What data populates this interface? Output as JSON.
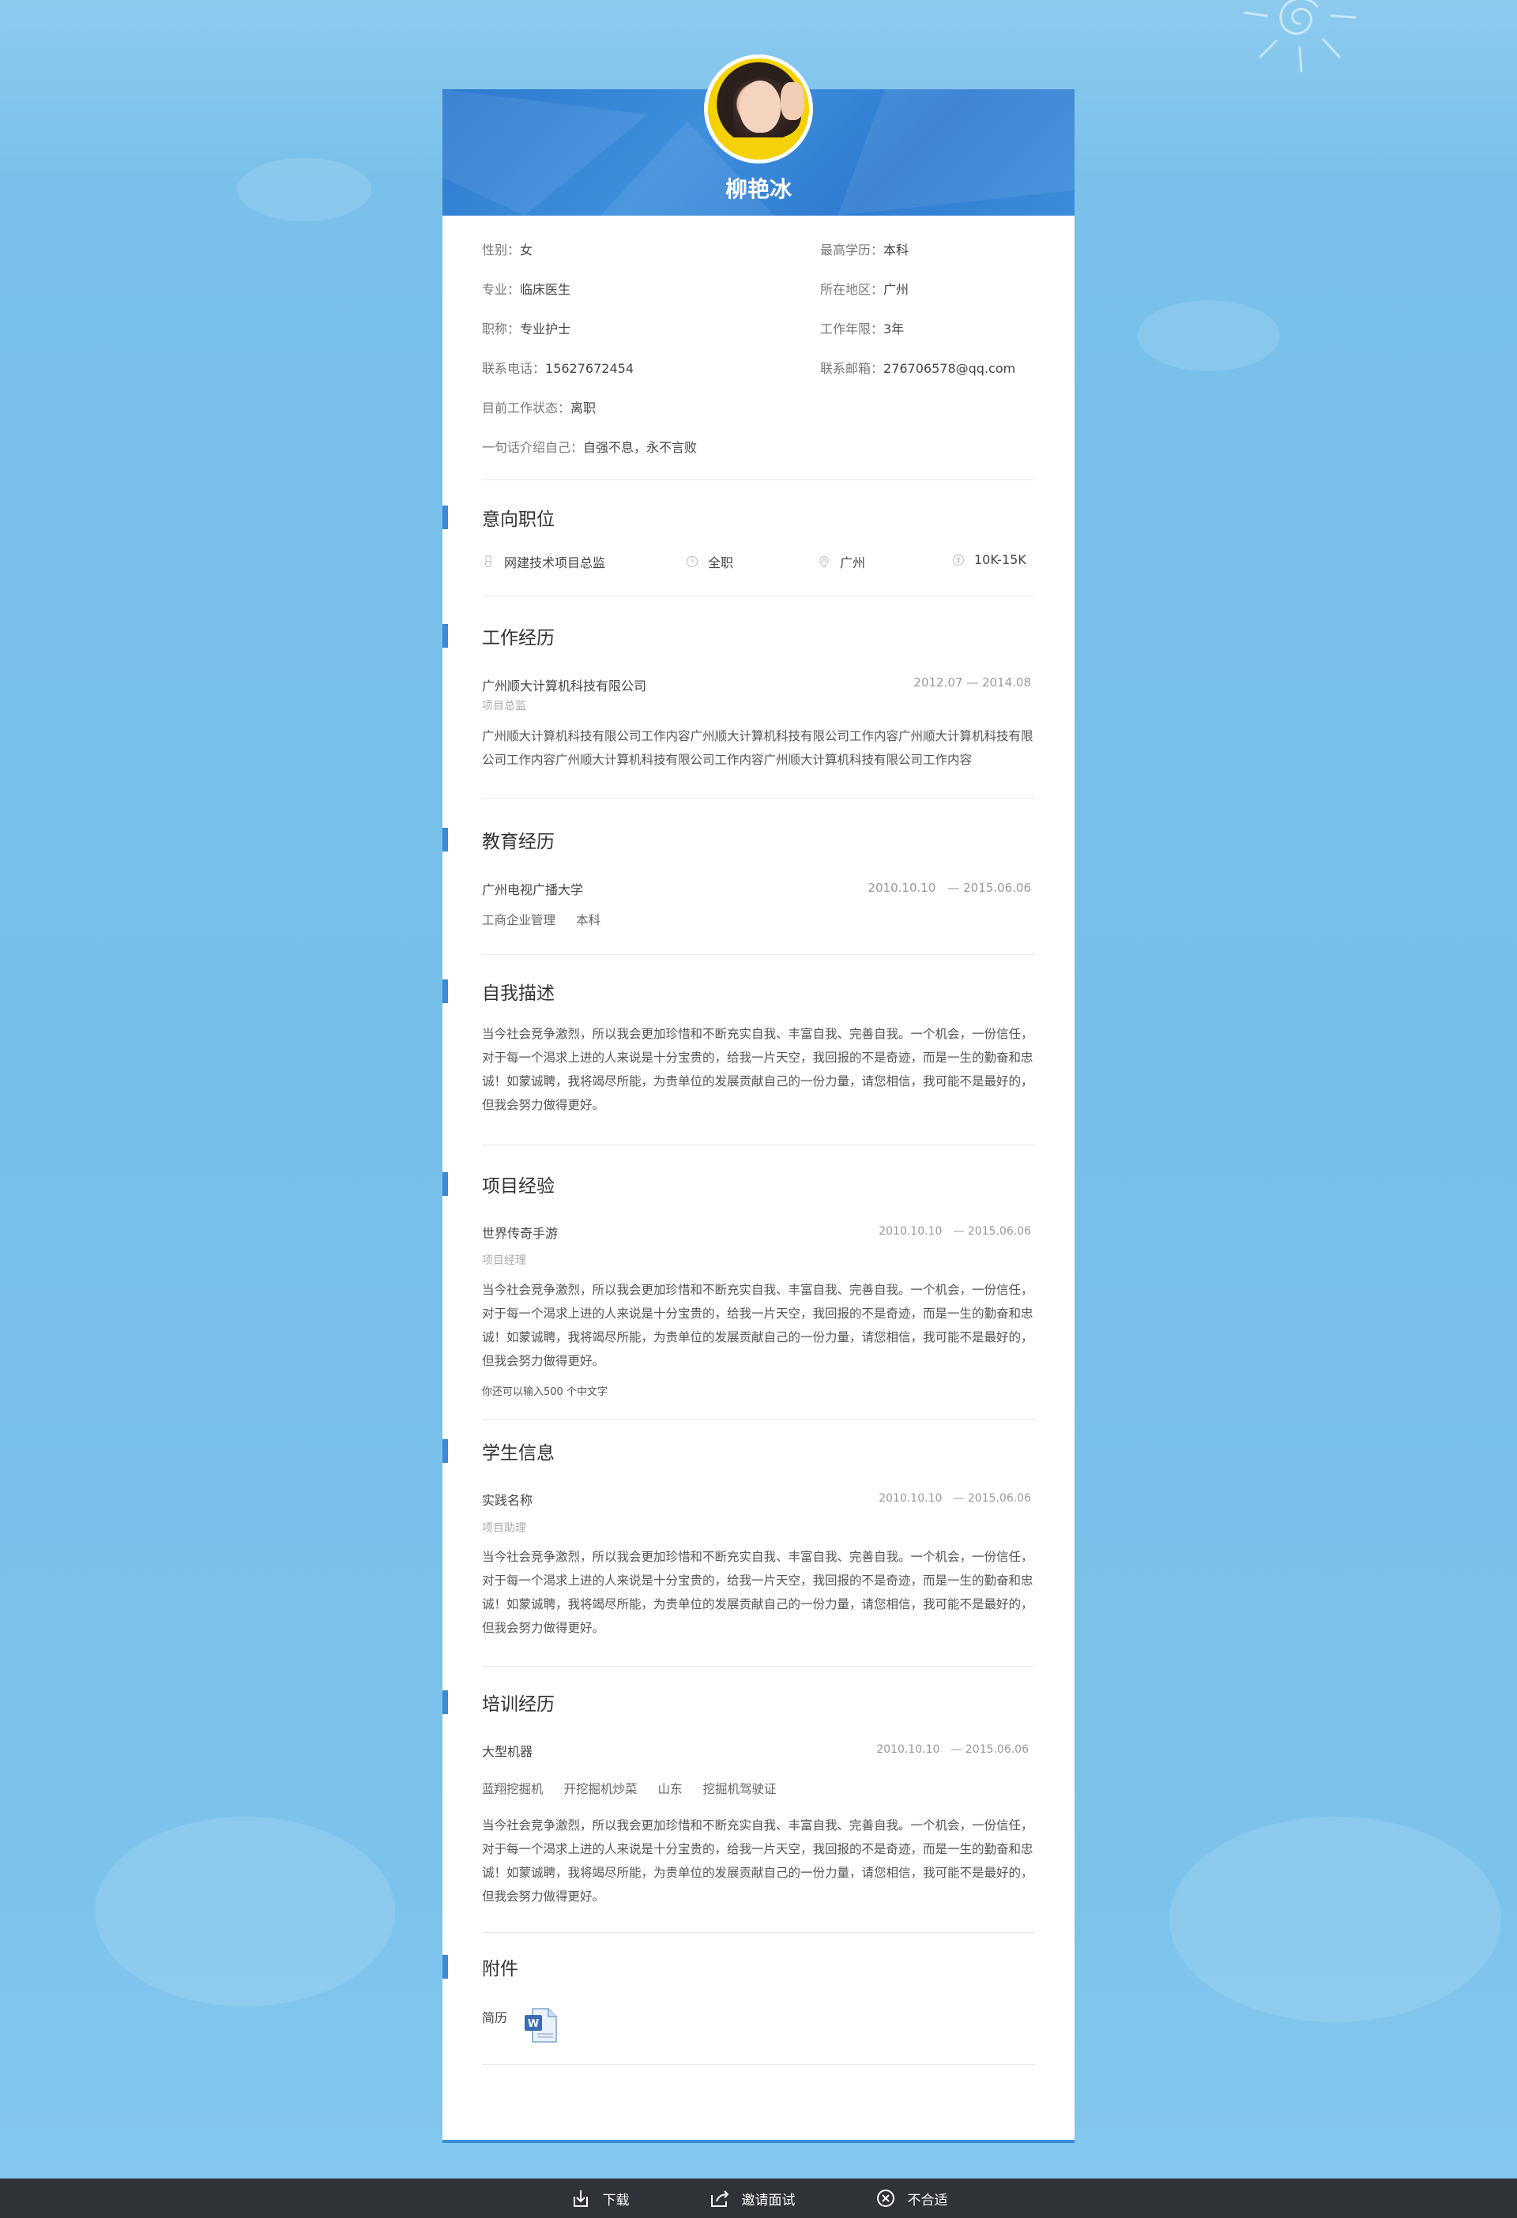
{
  "profile": {
    "name": "柳艳冰",
    "info": [
      {
        "label": "性别：",
        "value": "女"
      },
      {
        "label": "最高学历：",
        "value": "本科"
      },
      {
        "label": "专业：",
        "value": "临床医生"
      },
      {
        "label": "所在地区：",
        "value": "广州"
      },
      {
        "label": "职称：",
        "value": "专业护士"
      },
      {
        "label": "工作年限：",
        "value": "3年"
      },
      {
        "label": "联系电话：",
        "value": "15627672454"
      },
      {
        "label": "联系邮箱：",
        "value": "276706578@qq.com"
      },
      {
        "label": "目前工作状态：",
        "value": "离职"
      },
      {
        "label": "一句话介绍自己：",
        "value": "自强不息，永不言败"
      }
    ]
  },
  "intent": {
    "title": "意向职位",
    "items": [
      {
        "icon": "medal-icon",
        "text": "网建技术项目总监"
      },
      {
        "icon": "clock-icon",
        "text": "全职"
      },
      {
        "icon": "location-pin-icon",
        "text": "广州"
      },
      {
        "icon": "yuan-coin-icon",
        "text": "10K-15K"
      }
    ]
  },
  "work": {
    "title": "工作经历",
    "company": "广州顺大计算机科技有限公司",
    "date": "2012.07 — 2014.08",
    "role": "项目总监",
    "desc": "广州顺大计算机科技有限公司工作内容广州顺大计算机科技有限公司工作内容广州顺大计算机科技有限公司工作内容广州顺大计算机科技有限公司工作内容广州顺大计算机科技有限公司工作内容"
  },
  "education": {
    "title": "教育经历",
    "school": "广州电视广播大学",
    "date": "2010.10.10　— 2015.06.06",
    "major": "工商企业管理",
    "degree": "本科"
  },
  "self": {
    "title": "自我描述",
    "desc": "当今社会竞争激烈，所以我会更加珍惜和不断充实自我、丰富自我、完善自我。一个机会，一份信任，对于每一个渴求上进的人来说是十分宝贵的，给我一片天空，我回报的不是奇迹，而是一生的勤奋和忠诚！如蒙诚聘，我将竭尽所能，为贵单位的发展贡献自己的一份力量，请您相信，我可能不是最好的，但我会努力做得更好。"
  },
  "project": {
    "title": "项目经验",
    "name": "世界传奇手游",
    "date": "2010.10.10　— 2015.06.06",
    "role": "项目经理",
    "desc": "当今社会竞争激烈，所以我会更加珍惜和不断充实自我、丰富自我、完善自我。一个机会，一份信任，对于每一个渴求上进的人来说是十分宝贵的，给我一片天空，我回报的不是奇迹，而是一生的勤奋和忠诚！如蒙诚聘，我将竭尽所能，为贵单位的发展贡献自己的一份力量，请您相信，我可能不是最好的，但我会努力做得更好。",
    "note": "你还可以输入500 个中文字"
  },
  "student": {
    "title": "学生信息",
    "name": "实践名称",
    "date": "2010.10.10　— 2015.06.06",
    "role": "项目助理",
    "desc": "当今社会竞争激烈，所以我会更加珍惜和不断充实自我、丰富自我、完善自我。一个机会，一份信任，对于每一个渴求上进的人来说是十分宝贵的，给我一片天空，我回报的不是奇迹，而是一生的勤奋和忠诚！如蒙诚聘，我将竭尽所能，为贵单位的发展贡献自己的一份力量，请您相信，我可能不是最好的，但我会努力做得更好。"
  },
  "training": {
    "title": "培训经历",
    "name": "大型机器",
    "date": "2010.10.10　— 2015.06.06",
    "tags": [
      "蓝翔挖掘机",
      "开挖掘机炒菜",
      "山东",
      "挖掘机驾驶证"
    ],
    "desc": "当今社会竞争激烈，所以我会更加珍惜和不断充实自我、丰富自我、完善自我。一个机会，一份信任，对于每一个渴求上进的人来说是十分宝贵的，给我一片天空，我回报的不是奇迹，而是一生的勤奋和忠诚！如蒙诚聘，我将竭尽所能，为贵单位的发展贡献自己的一份力量，请您相信，我可能不是最好的，但我会努力做得更好。"
  },
  "attachment": {
    "title": "附件",
    "label": "简历",
    "icon": "word-document-icon"
  },
  "actions": {
    "download": "下载",
    "invite": "邀请面试",
    "reject": "不合适"
  },
  "colors": {
    "accent": "#3a8ad6",
    "bottom_bar": "#2f3236",
    "background": "#79c1ea"
  }
}
